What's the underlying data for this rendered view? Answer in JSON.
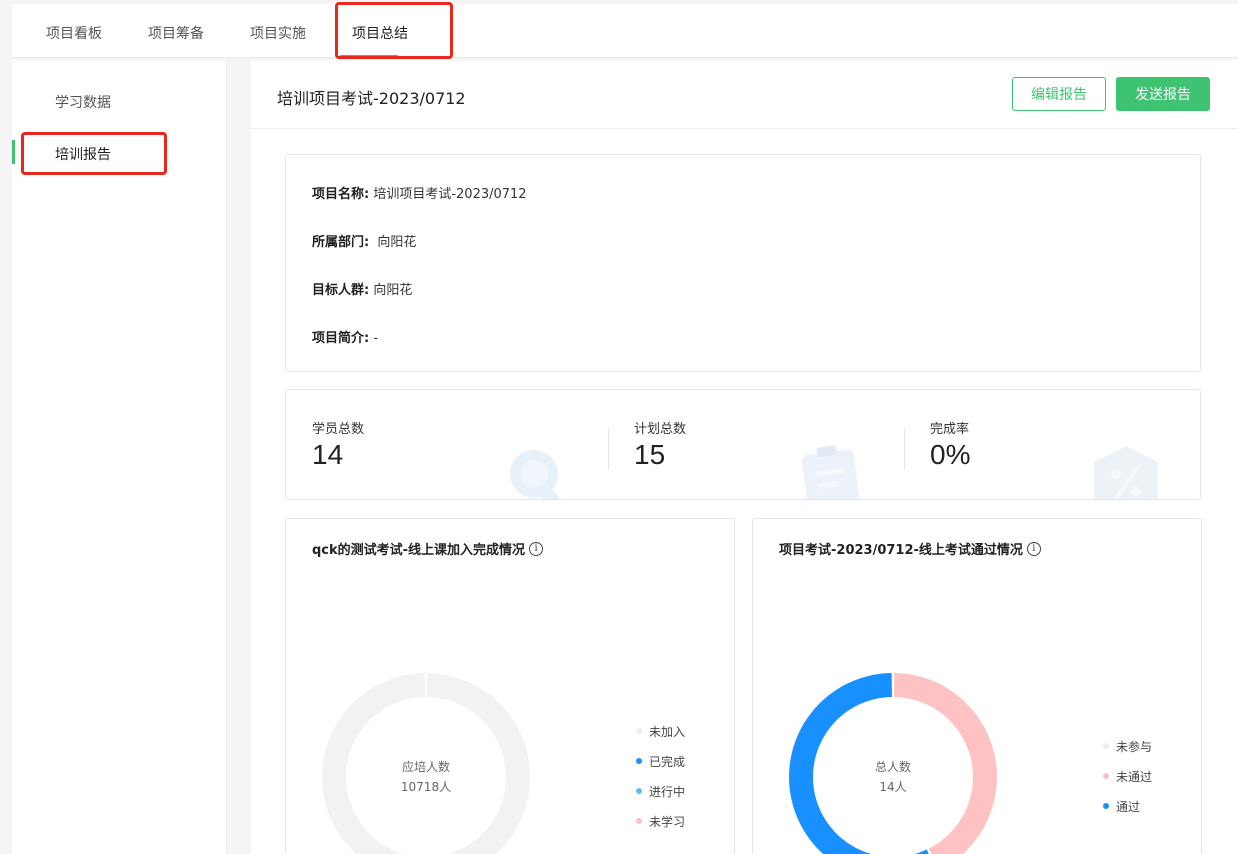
{
  "tabs": [
    {
      "label": "项目看板"
    },
    {
      "label": "项目筹备"
    },
    {
      "label": "项目实施"
    },
    {
      "label": "项目总结"
    }
  ],
  "sidebar": {
    "items": [
      {
        "label": "学习数据"
      },
      {
        "label": "培训报告"
      }
    ]
  },
  "header": {
    "title": "培训项目考试-2023/0712",
    "edit_label": "编辑报告",
    "send_label": "发送报告"
  },
  "info": {
    "name_label": "项目名称:",
    "name_value": "培训项目考试-2023/0712",
    "dept_label": "所属部门:",
    "dept_value": "向阳花",
    "target_label": "目标人群:",
    "target_value": "向阳花",
    "intro_label": "项目简介:",
    "intro_value": "-"
  },
  "stats": [
    {
      "label": "学员总数",
      "value": "14"
    },
    {
      "label": "计划总数",
      "value": "15"
    },
    {
      "label": "完成率",
      "value": "0%"
    }
  ],
  "charts": [
    {
      "title": "qck的测试考试-线上课加入完成情况",
      "center_label": "应培人数",
      "center_value": "10718人",
      "legend": [
        {
          "label": "未加入",
          "color": "#eeeeee"
        },
        {
          "label": "已完成",
          "color": "#1890ff"
        },
        {
          "label": "进行中",
          "color": "#5bc0f0"
        },
        {
          "label": "未学习",
          "color": "#ffbfbf"
        }
      ]
    },
    {
      "title": "项目考试-2023/0712-线上考试通过情况",
      "center_label": "总人数",
      "center_value": "14人",
      "legend": [
        {
          "label": "未参与",
          "color": "#eeeeee"
        },
        {
          "label": "未通过",
          "color": "#ffbfbf"
        },
        {
          "label": "通过",
          "color": "#1890ff"
        }
      ]
    }
  ],
  "chart_data": [
    {
      "type": "pie",
      "title": "qck的测试考试-线上课加入完成情况",
      "categories": [
        "未加入",
        "已完成",
        "进行中",
        "未学习"
      ],
      "values": [
        10718,
        0,
        0,
        0
      ],
      "colors": [
        "#f2f2f2",
        "#1890ff",
        "#5bc0f0",
        "#ffbfbf"
      ],
      "legend": "right"
    },
    {
      "type": "pie",
      "title": "项目考试-2023/0712-线上考试通过情况",
      "categories": [
        "未参与",
        "未通过",
        "通过"
      ],
      "values": [
        0,
        6,
        8
      ],
      "colors": [
        "#eeeeee",
        "#ffc2c2",
        "#1890ff"
      ],
      "legend": "right"
    }
  ]
}
